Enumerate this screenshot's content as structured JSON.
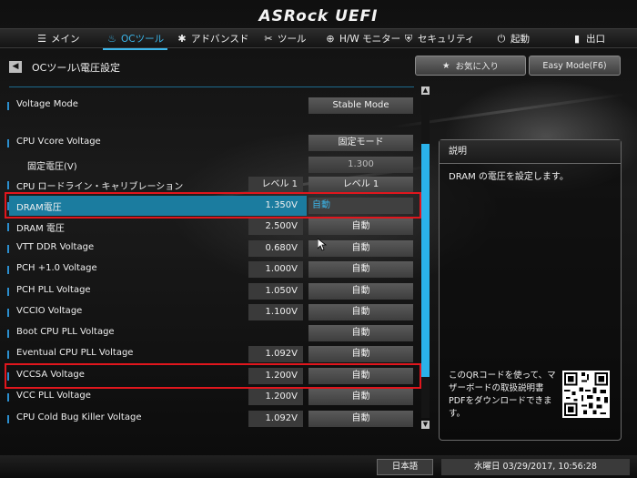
{
  "brand": "ASRock UEFI",
  "nav": [
    {
      "label": "メイン",
      "icon": "list-icon",
      "glyph": "☰"
    },
    {
      "label": "OCツール",
      "icon": "flame-icon",
      "glyph": "♨"
    },
    {
      "label": "アドバンスド",
      "icon": "star-icon",
      "glyph": "✱"
    },
    {
      "label": "ツール",
      "icon": "tools-icon",
      "glyph": "✂"
    },
    {
      "label": "H/W モニター",
      "icon": "monitor-icon",
      "glyph": "⊕"
    },
    {
      "label": "セキュリティ",
      "icon": "shield-icon",
      "glyph": "⛨"
    },
    {
      "label": "起動",
      "icon": "power-icon",
      "glyph": "⏻"
    },
    {
      "label": "出口",
      "icon": "exit-icon",
      "glyph": "▮"
    }
  ],
  "breadcrumb": "OCツール\\電圧設定",
  "favorites_label": "お気に入り",
  "easy_mode_label": "Easy Mode(F6)",
  "rows": [
    {
      "label": "Voltage Mode",
      "current": "",
      "option": "Stable Mode"
    },
    {
      "label": "CPU Vcore Voltage",
      "current": "",
      "option": "固定モード"
    },
    {
      "label": "固定電圧(V)",
      "current": "",
      "option": "1.300"
    },
    {
      "label": "CPU ロードライン・キャリブレーション",
      "current": "レベル 1",
      "option": "レベル 1"
    },
    {
      "label": "DRAM電圧",
      "current": "1.350V",
      "option": "自動"
    },
    {
      "label": "DRAM 電圧",
      "current": "2.500V",
      "option": "自動"
    },
    {
      "label": "VTT DDR Voltage",
      "current": "0.680V",
      "option": "自動"
    },
    {
      "label": "PCH +1.0 Voltage",
      "current": "1.000V",
      "option": "自動"
    },
    {
      "label": "PCH PLL Voltage",
      "current": "1.050V",
      "option": "自動"
    },
    {
      "label": "VCCIO Voltage",
      "current": "1.100V",
      "option": "自動"
    },
    {
      "label": "Boot CPU PLL Voltage",
      "current": "",
      "option": "自動"
    },
    {
      "label": "Eventual CPU PLL Voltage",
      "current": "1.092V",
      "option": "自動"
    },
    {
      "label": "VCCSA Voltage",
      "current": "1.200V",
      "option": "自動"
    },
    {
      "label": "VCC PLL Voltage",
      "current": "1.200V",
      "option": "自動"
    },
    {
      "label": "CPU Cold Bug Killer Voltage",
      "current": "1.092V",
      "option": "自動"
    }
  ],
  "description": {
    "title": "説明",
    "text": "DRAM の電圧を設定します。",
    "qr_text": "このQRコードを使って、マザーボードの取扱説明書PDFをダウンロードできます。"
  },
  "footer": {
    "language": "日本語",
    "datetime": "水曜日 03/29/2017, 10:56:28"
  },
  "colors": {
    "accent": "#3bb6ea",
    "highlight": "#e0161d",
    "selection": "#1b7c9f"
  }
}
